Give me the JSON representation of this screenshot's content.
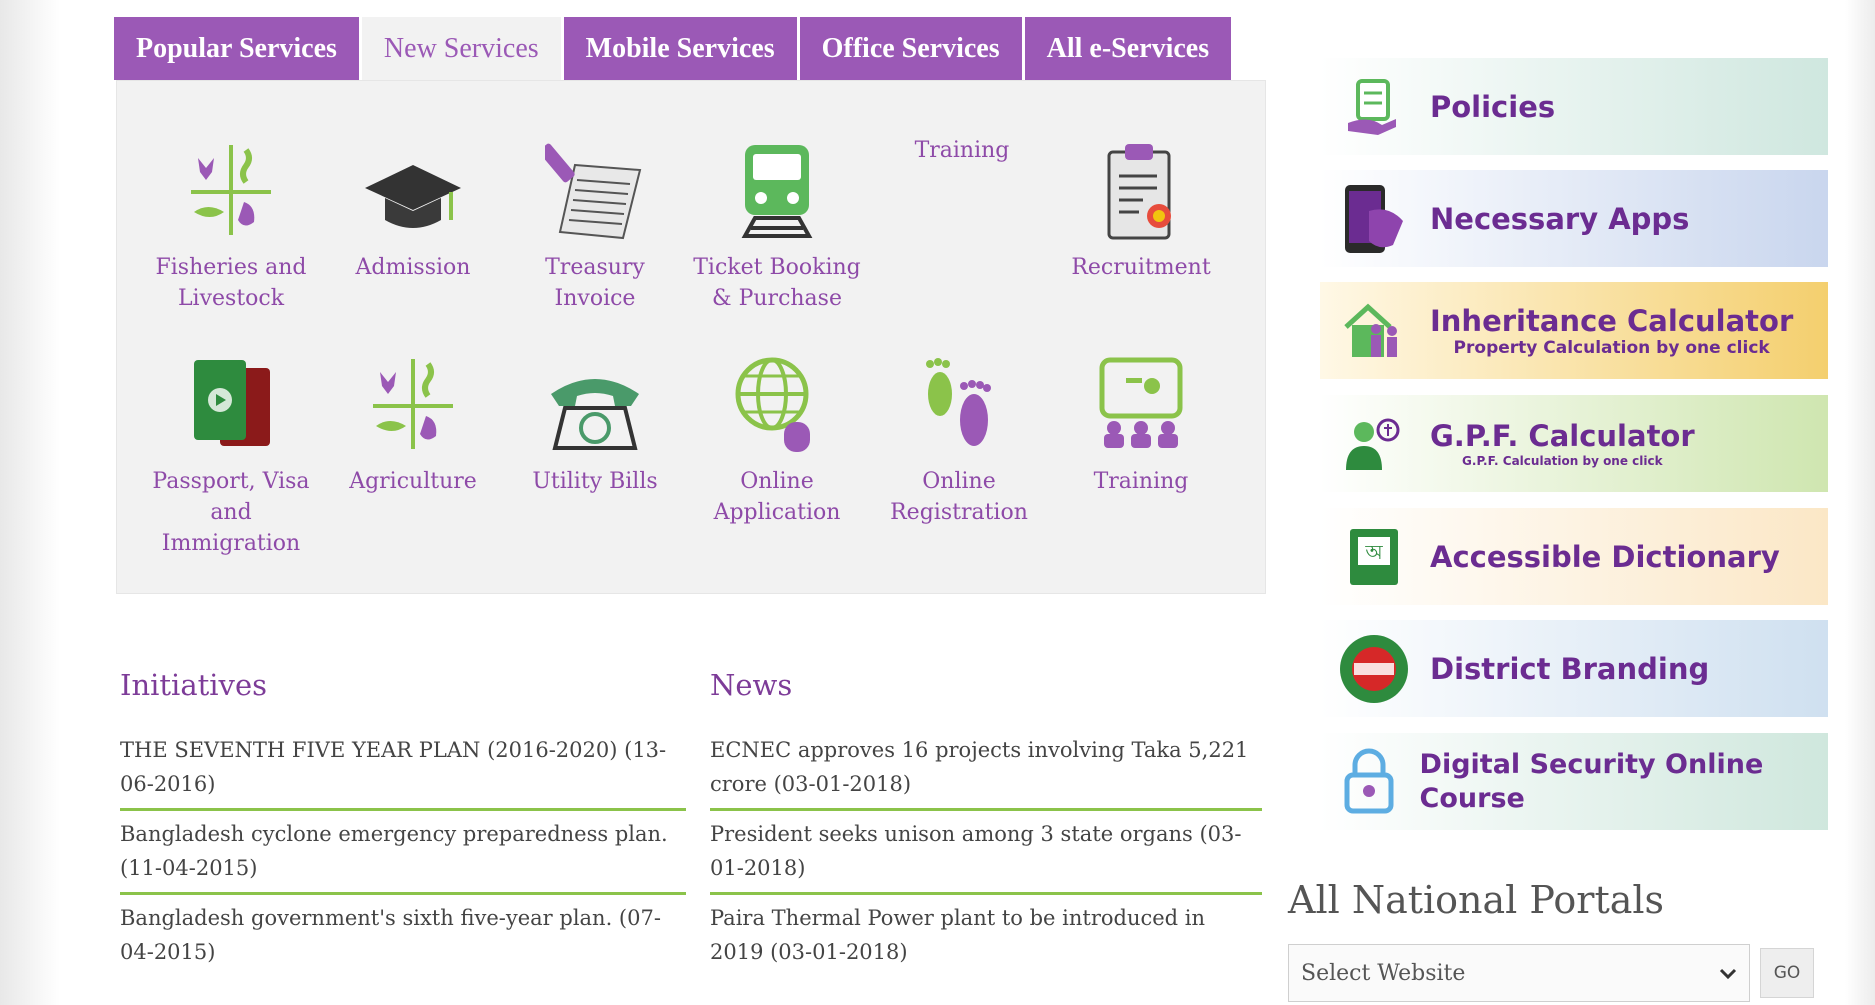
{
  "tabs": [
    {
      "label": "Popular Services",
      "active": false
    },
    {
      "label": "New Services",
      "active": true
    },
    {
      "label": "Mobile Services",
      "active": false
    },
    {
      "label": "Office Services",
      "active": false
    },
    {
      "label": "All e-Services",
      "active": false
    }
  ],
  "services": {
    "top_extra_label": "Training",
    "row1": [
      {
        "label": "Fisheries and Livestock",
        "icon": "fisheries-livestock-icon"
      },
      {
        "label": "Admission",
        "icon": "graduation-cap-icon"
      },
      {
        "label": "Treasury Invoice",
        "icon": "invoice-icon"
      },
      {
        "label": "Ticket Booking & Purchase",
        "icon": "train-icon"
      },
      {
        "label": "",
        "icon": ""
      },
      {
        "label": "Recruitment",
        "icon": "clipboard-icon"
      }
    ],
    "row2": [
      {
        "label": "Passport, Visa and Immigration",
        "icon": "passport-icon"
      },
      {
        "label": "Agriculture",
        "icon": "agriculture-icon"
      },
      {
        "label": "Utility Bills",
        "icon": "telephone-icon"
      },
      {
        "label": "Online Application",
        "icon": "globe-icon"
      },
      {
        "label": "Online Registration",
        "icon": "footprints-icon"
      },
      {
        "label": "Training",
        "icon": "training-board-icon"
      }
    ]
  },
  "initiatives": {
    "title": "Initiatives",
    "items": [
      "THE SEVENTH FIVE YEAR PLAN (2016-2020) (13-06-2016)",
      "Bangladesh cyclone emergency preparedness plan. (11-04-2015)",
      "Bangladesh government's sixth five-year plan. (07-04-2015)"
    ]
  },
  "news": {
    "title": "News",
    "items": [
      "ECNEC approves 16 projects involving Taka 5,221 crore (03-01-2018)",
      "President seeks unison among 3 state organs (03-01-2018)",
      "Paira Thermal Power plant to be introduced in 2019 (03-01-2018)"
    ]
  },
  "banners": [
    {
      "title": "Policies",
      "subtitle": "",
      "icon": "policy-document-icon",
      "bg_from": "#ffffff",
      "bg_to": "#cfe7df"
    },
    {
      "title": "Necessary Apps",
      "subtitle": "",
      "icon": "mobile-apps-icon",
      "bg_from": "#ffffff",
      "bg_to": "#c9d6ee"
    },
    {
      "title": "Inheritance Calculator",
      "subtitle": "Property Calculation by one click",
      "icon": "family-house-icon",
      "bg_from": "#fff8e6",
      "bg_to": "#f4cf6e"
    },
    {
      "title": "G.P.F. Calculator",
      "subtitle": "G.P.F. Calculation by one click",
      "icon": "person-money-icon",
      "bg_from": "#ffffff",
      "bg_to": "#cfe6b0"
    },
    {
      "title": "Accessible Dictionary",
      "subtitle": "",
      "icon": "dictionary-book-icon",
      "bg_from": "#ffffff",
      "bg_to": "#fbe7c6"
    },
    {
      "title": "District Branding",
      "subtitle": "",
      "icon": "district-branding-logo",
      "bg_from": "#ffffff",
      "bg_to": "#cfe0f0"
    },
    {
      "title": "Digital Security Online Course",
      "subtitle": "",
      "icon": "security-lock-icon",
      "bg_from": "#ffffff",
      "bg_to": "#cfe7dd"
    }
  ],
  "portals": {
    "title": "All National Portals",
    "select_value": "Select Website",
    "go_label": "GO"
  },
  "colors": {
    "brand_purple": "#9b59b6",
    "accent_green": "#8bc34a"
  }
}
